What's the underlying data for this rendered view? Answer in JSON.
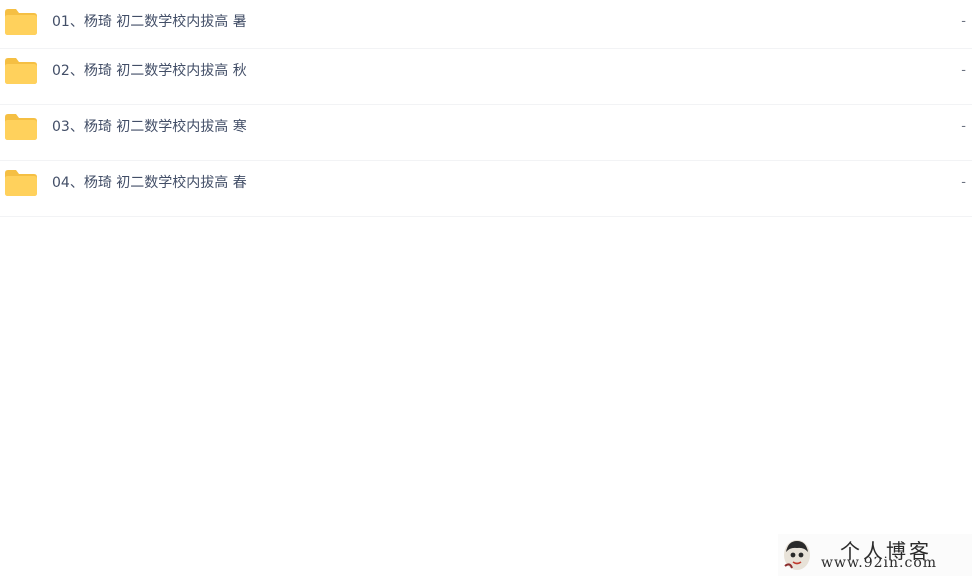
{
  "files": [
    {
      "name": "01、杨琦 初二数学校内拔高 暑",
      "size": "-",
      "icon": "folder-icon"
    },
    {
      "name": "02、杨琦 初二数学校内拔高 秋",
      "size": "-",
      "icon": "folder-icon"
    },
    {
      "name": "03、杨琦 初二数学校内拔高 寒",
      "size": "-",
      "icon": "folder-icon"
    },
    {
      "name": "04、杨琦 初二数学校内拔高 春",
      "size": "-",
      "icon": "folder-icon"
    }
  ],
  "watermark": {
    "title": "个人博客",
    "url": "www.92in.com"
  },
  "colors": {
    "folder": "#ffd15c",
    "folder_tab": "#f5bf43",
    "text": "#424e67",
    "divider": "#f2f3f5"
  }
}
